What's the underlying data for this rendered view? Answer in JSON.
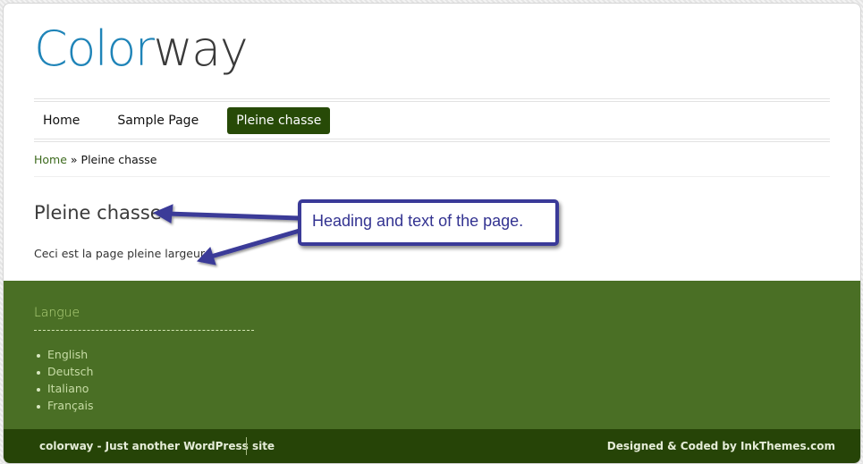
{
  "site": {
    "logo_part1": "Color",
    "logo_part2": "way"
  },
  "nav": {
    "items": [
      {
        "label": "Home"
      },
      {
        "label": "Sample Page"
      },
      {
        "label": "Pleine chasse",
        "active": true
      }
    ]
  },
  "breadcrumb": {
    "home": "Home",
    "separator": "»",
    "current": "Pleine chasse"
  },
  "page": {
    "title": "Pleine chasse",
    "text": "Ceci est la page pleine largeur."
  },
  "annotation": {
    "label": "Heading and text of the page."
  },
  "footer": {
    "widget_title": "Langue",
    "languages": [
      "English",
      "Deutsch",
      "Italiano",
      "Français"
    ],
    "tagline": "colorway - Just another WordPress site",
    "credit": "Designed & Coded by InkThemes.com"
  },
  "colors": {
    "logo_accent": "#1f84b8",
    "nav_active": "#274a07",
    "footer": "#4a6f25",
    "footer_bottom": "#264407",
    "annotation": "#3a3a98"
  }
}
